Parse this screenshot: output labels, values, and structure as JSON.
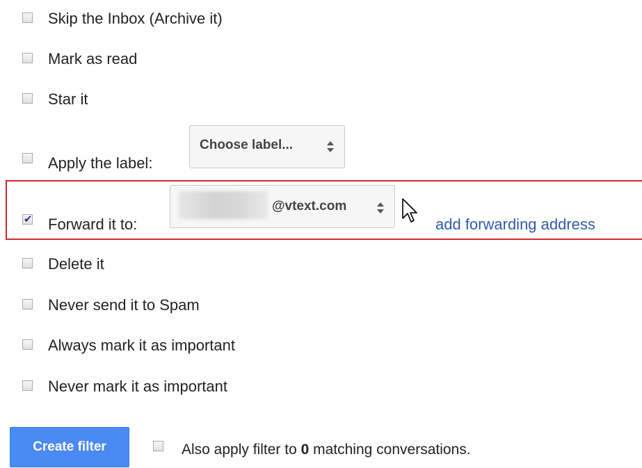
{
  "actions": {
    "skip_inbox": {
      "label": "Skip the Inbox (Archive it)",
      "checked": false
    },
    "mark_read": {
      "label": "Mark as read",
      "checked": false
    },
    "star_it": {
      "label": "Star it",
      "checked": false
    },
    "apply_label": {
      "label": "Apply the label:",
      "checked": false,
      "select_value": "Choose label..."
    },
    "forward": {
      "label": "Forward it to:",
      "checked": true,
      "select_value": "@vtext.com",
      "add_link": "add forwarding address"
    },
    "delete_it": {
      "label": "Delete it",
      "checked": false
    },
    "never_spam": {
      "label": "Never send it to Spam",
      "checked": false
    },
    "always_important": {
      "label": "Always mark it as important",
      "checked": false
    },
    "never_important": {
      "label": "Never mark it as important",
      "checked": false
    }
  },
  "footer": {
    "create_button": "Create filter",
    "also_apply_prefix": "Also apply filter to ",
    "also_apply_count": "0",
    "also_apply_suffix": " matching conversations.",
    "also_apply_checked": false
  },
  "colors": {
    "highlight_box": "#d5272d",
    "link": "#2f5aa8",
    "button": "#4a8af4"
  }
}
